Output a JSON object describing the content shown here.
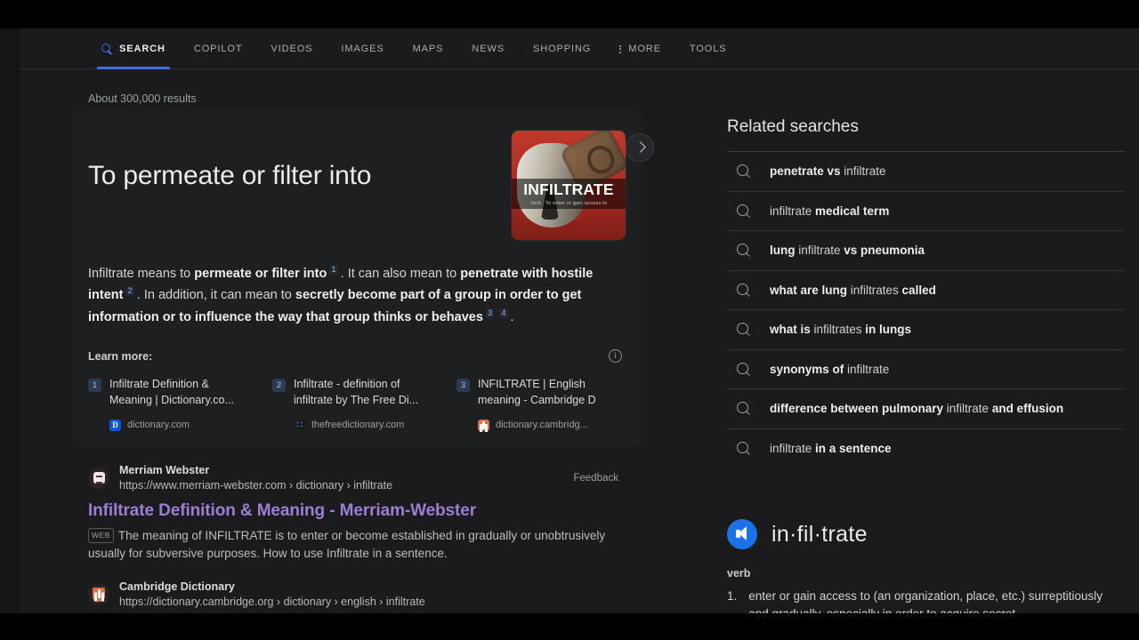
{
  "nav": {
    "tabs": [
      {
        "label": "SEARCH",
        "icon": "search-icon",
        "active": true
      },
      {
        "label": "COPILOT",
        "active": false
      },
      {
        "label": "VIDEOS",
        "active": false
      },
      {
        "label": "IMAGES",
        "active": false
      },
      {
        "label": "MAPS",
        "active": false
      },
      {
        "label": "NEWS",
        "active": false
      },
      {
        "label": "SHOPPING",
        "active": false
      },
      {
        "label": "MORE",
        "icon": "more-vertical-icon",
        "active": false
      },
      {
        "label": "TOOLS",
        "active": false
      }
    ]
  },
  "results_count": "About 300,000 results",
  "answer": {
    "title": "To permeate or filter into",
    "thumbnail": {
      "headline": "INFILTRATE",
      "caption": "Verb : To enter or gain access to"
    },
    "paragraph": [
      {
        "text": "Infiltrate means to ",
        "bold": false
      },
      {
        "text": "permeate or filter into",
        "bold": true
      },
      {
        "cite": "1"
      },
      {
        "text": ". It can also mean to ",
        "bold": false
      },
      {
        "text": "penetrate with hostile intent",
        "bold": true
      },
      {
        "cite": "2"
      },
      {
        "text": ". In addition, it can mean to ",
        "bold": false
      },
      {
        "text": "secretly become part of a group in order to get information or to influence the way that group thinks or behaves",
        "bold": true
      },
      {
        "cite": "3"
      },
      {
        "cite": "4"
      },
      {
        "text": ".",
        "bold": false
      }
    ],
    "learn_more_label": "Learn more:",
    "info_icon": "info-icon",
    "feedback_label": "Feedback",
    "next_icon": "chevron-right-icon",
    "sources": [
      {
        "num": "1",
        "title": "Infiltrate Definition & Meaning | Dictionary.co...",
        "domain": "dictionary.com",
        "favicon": "dictionary-favicon"
      },
      {
        "num": "2",
        "title": "Infiltrate - definition of infiltrate by The Free Di...",
        "domain": "thefreedictionary.com",
        "favicon": "freedictionary-favicon"
      },
      {
        "num": "3",
        "title": "INFILTRATE | English meaning - Cambridge D",
        "domain": "dictionary.cambridg...",
        "favicon": "cambridge-favicon"
      }
    ]
  },
  "results": [
    {
      "site": "Merriam Webster",
      "url": "https://www.merriam-webster.com › dictionary › infiltrate",
      "title": "Infiltrate Definition & Meaning - Merriam-Webster",
      "badge": "WEB",
      "snippet": "The meaning of INFILTRATE is to enter or become established in gradually or unobtrusively usually for subversive purposes. How to use Infiltrate in a sentence.",
      "favicon": "merriam-webster-favicon"
    },
    {
      "site": "Cambridge Dictionary",
      "url": "https://dictionary.cambridge.org › dictionary › english › infiltrate",
      "title": "",
      "badge": "",
      "snippet": "",
      "favicon": "cambridge-favicon"
    }
  ],
  "related": {
    "title": "Related searches",
    "items": [
      [
        {
          "t": "penetrate vs",
          "b": true
        },
        {
          "t": " infiltrate",
          "b": false
        }
      ],
      [
        {
          "t": "infiltrate ",
          "b": false
        },
        {
          "t": "medical term",
          "b": true
        }
      ],
      [
        {
          "t": "lung",
          "b": true
        },
        {
          "t": " infiltrate ",
          "b": false
        },
        {
          "t": "vs pneumonia",
          "b": true
        }
      ],
      [
        {
          "t": "what are lung",
          "b": true
        },
        {
          "t": " infiltrates ",
          "b": false
        },
        {
          "t": "called",
          "b": true
        }
      ],
      [
        {
          "t": "what is",
          "b": true
        },
        {
          "t": " infiltrates ",
          "b": false
        },
        {
          "t": "in lungs",
          "b": true
        }
      ],
      [
        {
          "t": "synonyms of",
          "b": true
        },
        {
          "t": " infiltrate",
          "b": false
        }
      ],
      [
        {
          "t": "difference between pulmonary",
          "b": true
        },
        {
          "t": " infiltrate ",
          "b": false
        },
        {
          "t": "and effusion",
          "b": true
        }
      ],
      [
        {
          "t": "infiltrate ",
          "b": false
        },
        {
          "t": "in a sentence",
          "b": true
        }
      ]
    ]
  },
  "pronunciation": {
    "speaker_icon": "speaker-icon",
    "word": "in·fil·trate",
    "part_of_speech": "verb",
    "definitions": [
      {
        "num": "1.",
        "text": "enter or gain access to (an organization, place, etc.) surreptitiously and gradually, especially in order to acquire secret"
      }
    ]
  }
}
